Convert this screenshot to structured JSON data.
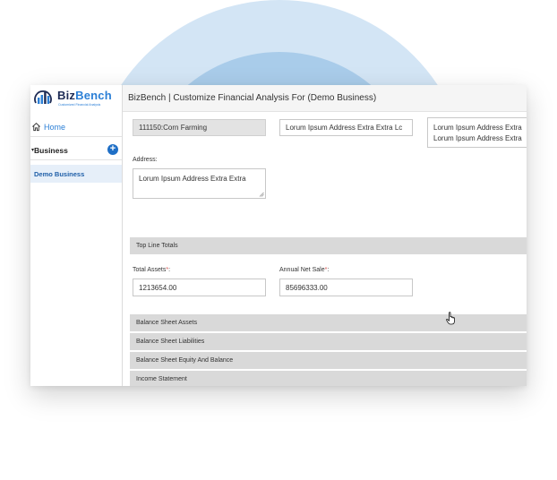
{
  "brand": {
    "name_part1": "Biz",
    "name_part2": "Bench",
    "tagline": "Customized Financial Analysis",
    "colors": {
      "navy": "#1d2b55",
      "blue": "#2b7fd6",
      "accent": "#1f6fc6"
    }
  },
  "header": {
    "title": "BizBench | Customize Financial Analysis For (Demo Business)"
  },
  "sidebar": {
    "home_label": "Home",
    "home_icon": "home-icon",
    "business_caret": "▾",
    "business_label": "Business",
    "add_icon": "plus-icon",
    "add_symbol": "+",
    "sub_item_label": "Demo Business"
  },
  "form": {
    "industry_value": "111150:Corn Farming",
    "address_line_value": "Lorum  Ipsum Address Extra Extra Lc",
    "address_box_value": "Lorum  Ipsum Address Extra Lorum  Ipsum Address Extra",
    "address_label": "Address:",
    "address_value": "Lorum  Ipsum Address Extra Extra"
  },
  "top_line": {
    "section_title": "Top Line Totals",
    "total_assets_label": "Total Assets",
    "total_assets_value": "1213654.00",
    "annual_net_sale_label": "Annual Net Sale",
    "annual_net_sale_value": "85696333.00",
    "required_mark": "*",
    "label_suffix": ":"
  },
  "sections": [
    "Balance Sheet Assets",
    "Balance Sheet Liabilities",
    "Balance Sheet Equity And Balance",
    "Income Statement"
  ]
}
